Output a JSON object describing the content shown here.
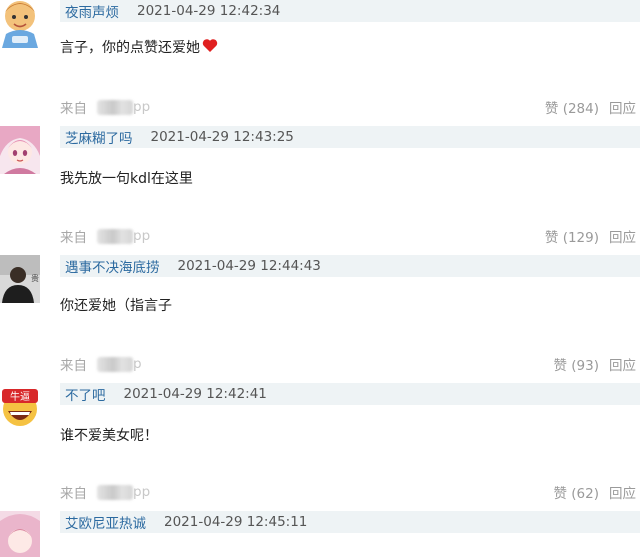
{
  "comments": [
    {
      "username": "夜雨声烦",
      "timestamp": "2021-04-29 12:42:34",
      "text": "言子，你的点赞还爱她",
      "from_label": "来自",
      "source_suffix": "pp",
      "like_label": "赞 (284)",
      "reply_label": "回应",
      "has_heart": true
    },
    {
      "username": "芝麻糊了吗",
      "timestamp": "2021-04-29 12:43:25",
      "text": "我先放一句kdl在这里",
      "from_label": "来自",
      "source_suffix": "pp",
      "like_label": "赞 (129)",
      "reply_label": "回应"
    },
    {
      "username": "遇事不决海底捞",
      "timestamp": "2021-04-29 12:44:43",
      "text": "你还爱她（指言子",
      "from_label": "来自",
      "source_suffix": "p",
      "like_label": "赞 (93)",
      "reply_label": "回应"
    },
    {
      "username": "不了吧",
      "timestamp": "2021-04-29 12:42:41",
      "text": "谁不爱美女呢！",
      "from_label": "来自",
      "source_suffix": "pp",
      "like_label": "赞 (62)",
      "reply_label": "回应",
      "avatar_text": "牛逼"
    },
    {
      "username": "艾欧尼亚热诚",
      "timestamp": "2021-04-29 12:45:11",
      "text": "",
      "from_label": "",
      "source_suffix": "",
      "like_label": "",
      "reply_label": ""
    }
  ],
  "colors": {
    "name_bar_bg": "#eef3f5",
    "username": "#2c6aa0",
    "heart": "#e02020"
  },
  "icons": [
    "cartoon-avatar-icon",
    "anime-girl-avatar-icon",
    "photo-avatar-icon",
    "grin-emoji-avatar-icon",
    "heart-icon"
  ]
}
